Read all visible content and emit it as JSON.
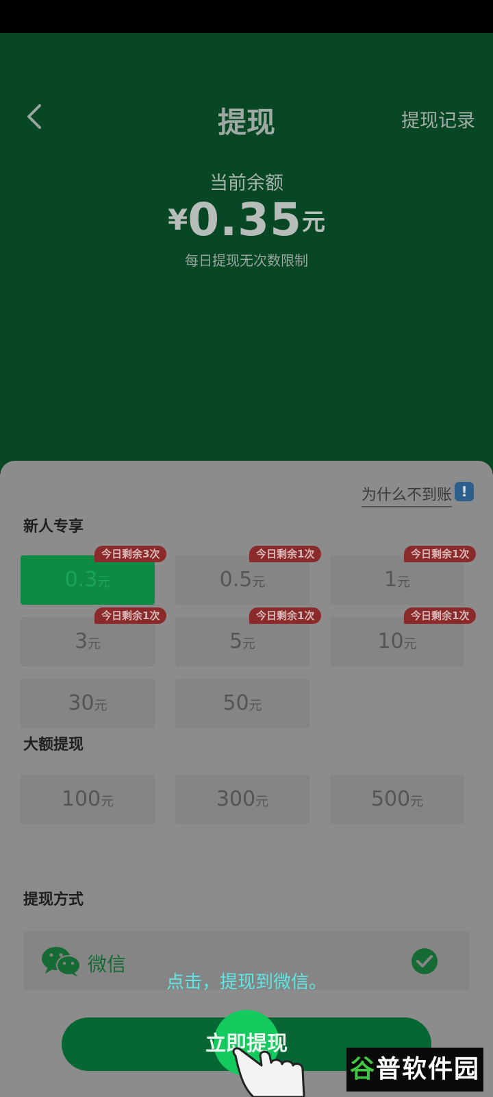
{
  "header": {
    "title": "提现",
    "records_label": "提现记录",
    "balance_label": "当前余额",
    "balance_symbol": "¥",
    "balance_value": "0.35",
    "balance_unit": "元",
    "daily_note": "每日提现无次数限制"
  },
  "why_link": "为什么不到账",
  "why_icon": "!",
  "sections": {
    "newcomer": "新人专享",
    "large": "大额提现",
    "method": "提现方式"
  },
  "unit": "元",
  "newcomer_options": [
    {
      "value": "0.3",
      "badge": "今日剩余3次"
    },
    {
      "value": "0.5",
      "badge": "今日剩余1次"
    },
    {
      "value": "1",
      "badge": "今日剩余1次"
    },
    {
      "value": "3",
      "badge": "今日剩余1次"
    },
    {
      "value": "5",
      "badge": "今日剩余1次"
    },
    {
      "value": "10",
      "badge": "今日剩余1次"
    },
    {
      "value": "30"
    },
    {
      "value": "50"
    }
  ],
  "large_options": [
    {
      "value": "100"
    },
    {
      "value": "300"
    },
    {
      "value": "500"
    }
  ],
  "method": {
    "label": "微信",
    "icon": "wechat-icon"
  },
  "hint": "点击，提现到微信。",
  "withdraw_button": "立即提现",
  "watermark": {
    "first": "谷",
    "rest": "普软件园"
  },
  "colors": {
    "brand_green": "#0e7b41",
    "badge_red": "#8b2a2a"
  }
}
